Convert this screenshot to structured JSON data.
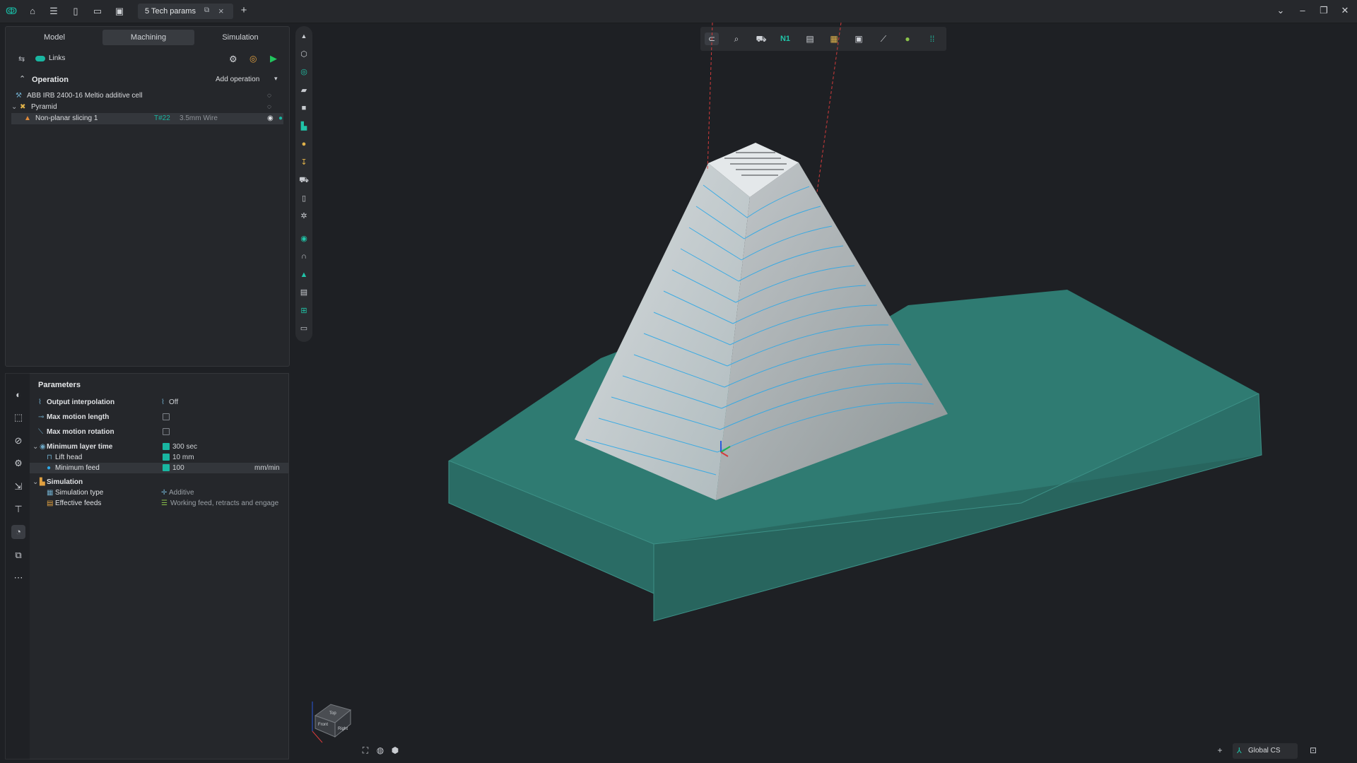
{
  "titlebar": {
    "tab_label": "5 Tech params",
    "add_tab": "+",
    "icons": [
      "app-logo-icon",
      "home-icon",
      "menu-icon",
      "new-file-icon",
      "open-folder-icon",
      "save-icon"
    ]
  },
  "mode_tabs": [
    "Model",
    "Machining",
    "Simulation"
  ],
  "links_label": "Links",
  "operation": {
    "heading": "Operation",
    "add_operation": "Add operation",
    "tree": [
      {
        "label": "ABB IRB 2400-16 Meltio additive cell"
      },
      {
        "label": "Pyramid"
      },
      {
        "label": "Non-planar slicing 1",
        "tool": "T#22",
        "material": "3.5mm Wire"
      }
    ]
  },
  "parameters": {
    "heading": "Parameters",
    "rows": [
      {
        "label": "Output interpolation",
        "value": "Off"
      },
      {
        "label": "Max motion length",
        "value": ""
      },
      {
        "label": "Max motion rotation",
        "value": ""
      },
      {
        "label": "Minimum layer time",
        "value": "300 sec"
      },
      {
        "label": "Lift head",
        "value": "10 mm"
      },
      {
        "label": "Minimum feed",
        "value": "100",
        "unit": "mm/min"
      },
      {
        "label": "Simulation",
        "value": ""
      },
      {
        "label": "Simulation type",
        "value": "Additive"
      },
      {
        "label": "Effective feeds",
        "value": "Working feed, retracts and engage"
      }
    ]
  },
  "toolbar_top": {
    "n1_label": "N1"
  },
  "viewcube": {
    "top": "Top",
    "front": "Front",
    "right": "Right"
  },
  "status": {
    "cs_label": "Global CS",
    "add": "+"
  },
  "colors": {
    "accent": "#19b6a1",
    "background": "#1e2024",
    "panel": "#25272b",
    "part": "#c9d3d6",
    "stock": "#2f8078",
    "toolpath": "#2ea8e6"
  }
}
